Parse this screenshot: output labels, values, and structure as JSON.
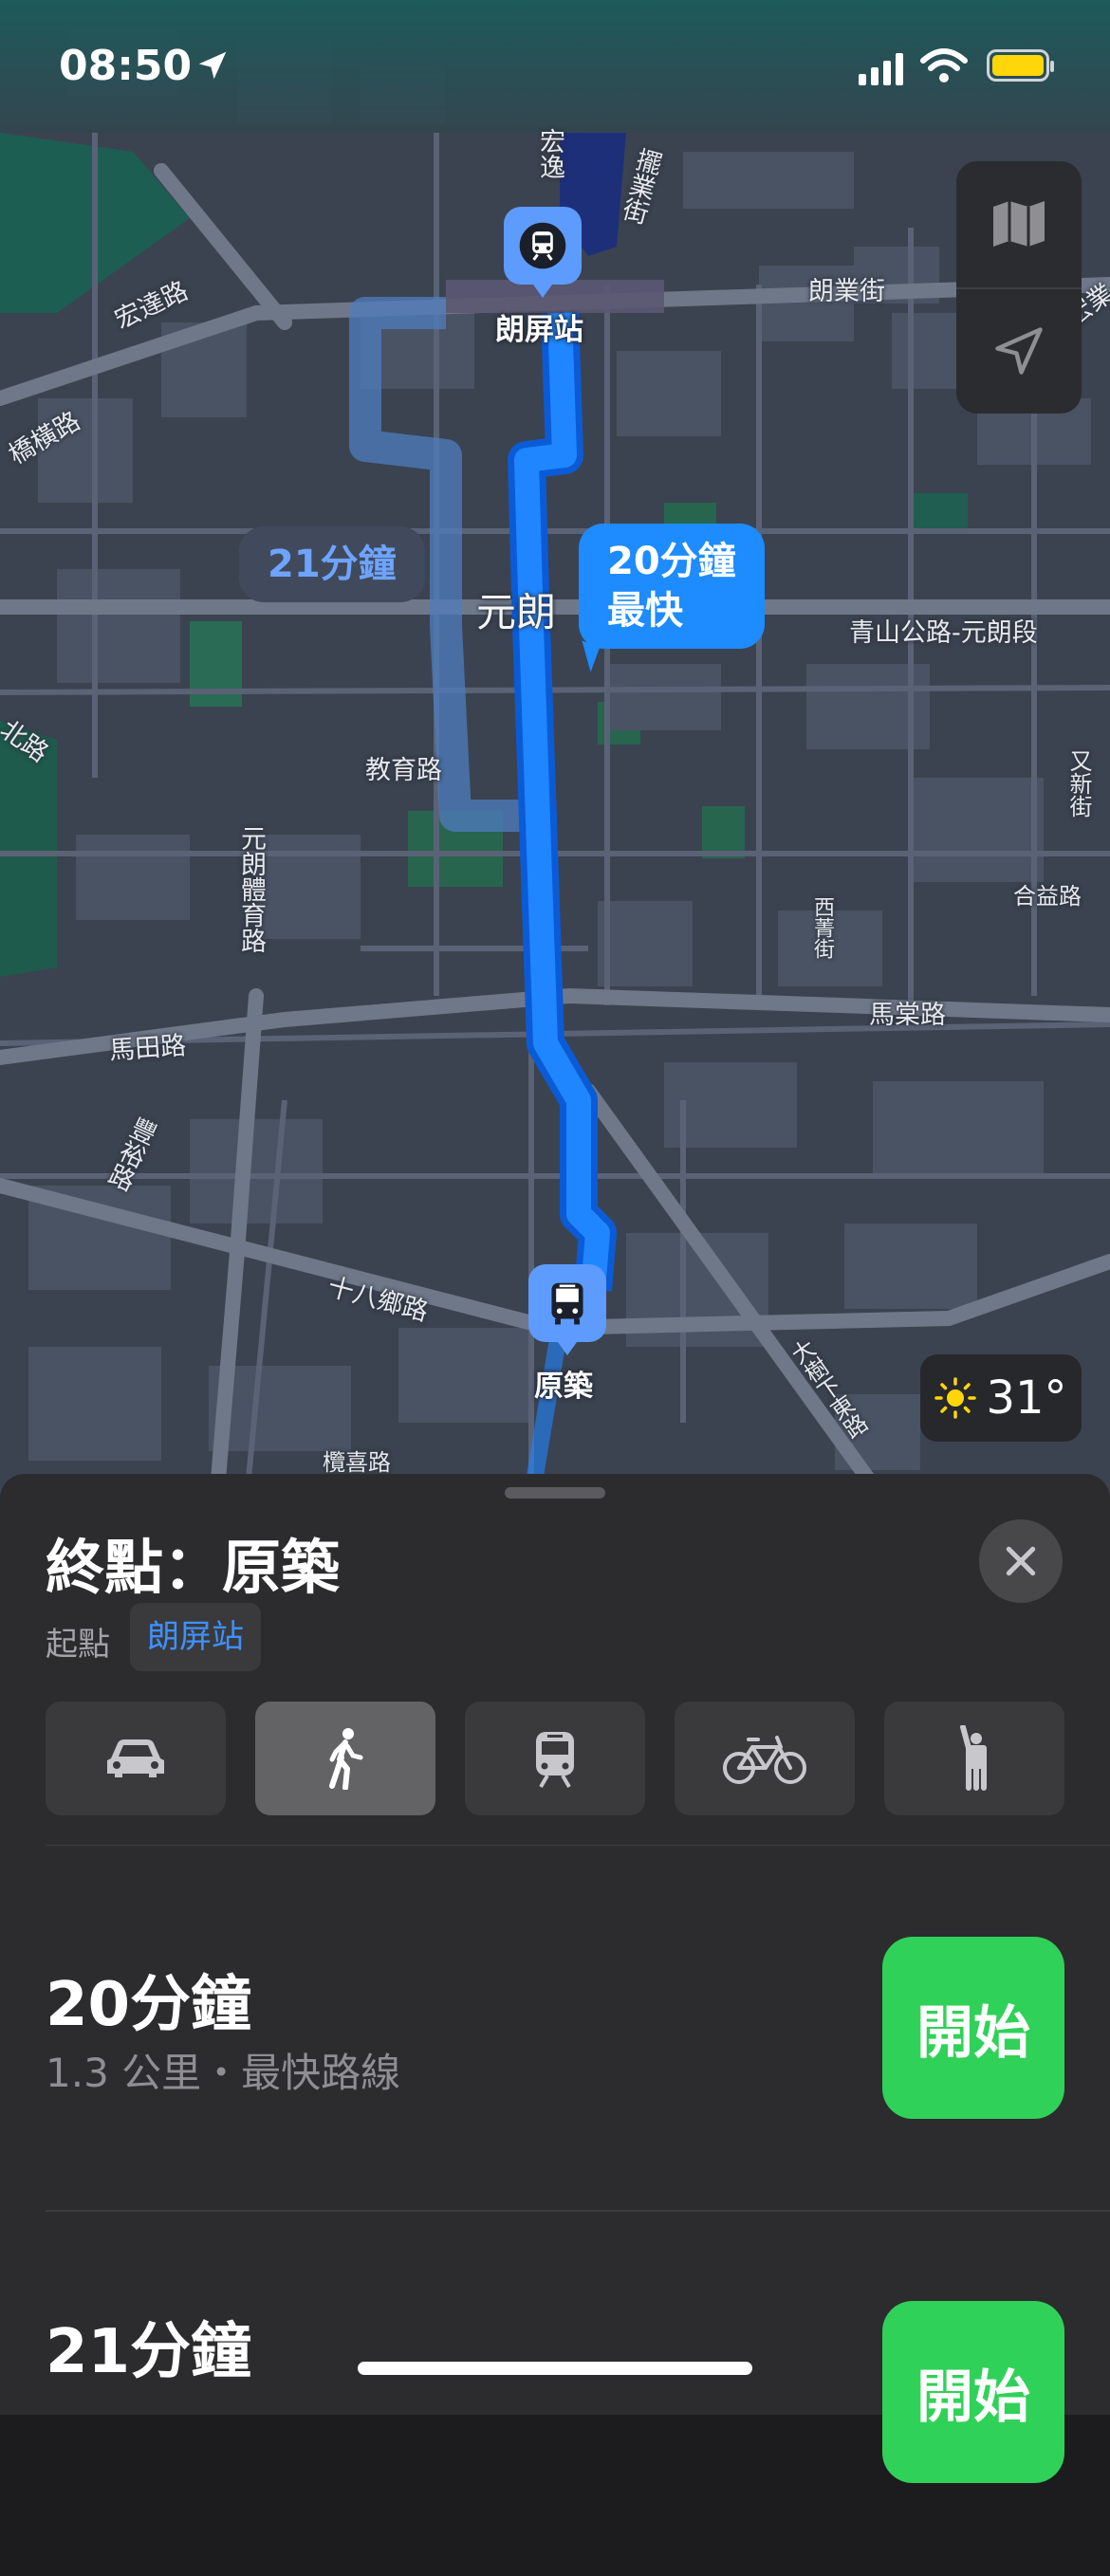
{
  "status": {
    "time": "08:50"
  },
  "map": {
    "labels": {
      "hongda": "宏達路",
      "hongyi": "宏逸",
      "pok_oi_south": "擺業街",
      "long_ping_st": "朗業街",
      "hong_yip": "宏業",
      "kiu_hang": "橋橫路",
      "yuen_long": "元朗",
      "castle_peak": "青山公路-元朗段",
      "kau_yuk": "教育路",
      "yuen_long_sports": "元朗體育路",
      "ma_tin": "馬田路",
      "fung_yu": "豐裕路",
      "sai_ching": "西菁街",
      "hop_yick": "合益路",
      "ma_tong": "馬棠路",
      "shap_pat_heung": "十八鄉路",
      "tai_shu_ha": "大樹下東路",
      "kam_hei": "欖喜路",
      "yau_san": "又新街",
      "north": "北路"
    },
    "bubble_alt": "21分鐘",
    "bubble_main_time": "20分鐘",
    "bubble_main_note": "最快",
    "start_stop": "朗屏站",
    "end_stop": "原築",
    "weather": "31°",
    "icons": {
      "map_mode": "map-icon",
      "locate": "location-arrow-icon",
      "train": "train-icon",
      "bus": "bus-icon",
      "sun": "sun-icon"
    }
  },
  "sheet": {
    "title": "終點：原築",
    "origin_label": "起點",
    "origin_value": "朗屏站",
    "modes": [
      "car-icon",
      "walk-icon",
      "transit-icon",
      "bicycle-icon",
      "rideshare-icon"
    ],
    "routes": [
      {
        "time": "20分鐘",
        "detail": "1.3 公里・最快路線",
        "button": "開始"
      },
      {
        "time": "21分鐘",
        "detail": "",
        "button": "開始"
      }
    ]
  }
}
